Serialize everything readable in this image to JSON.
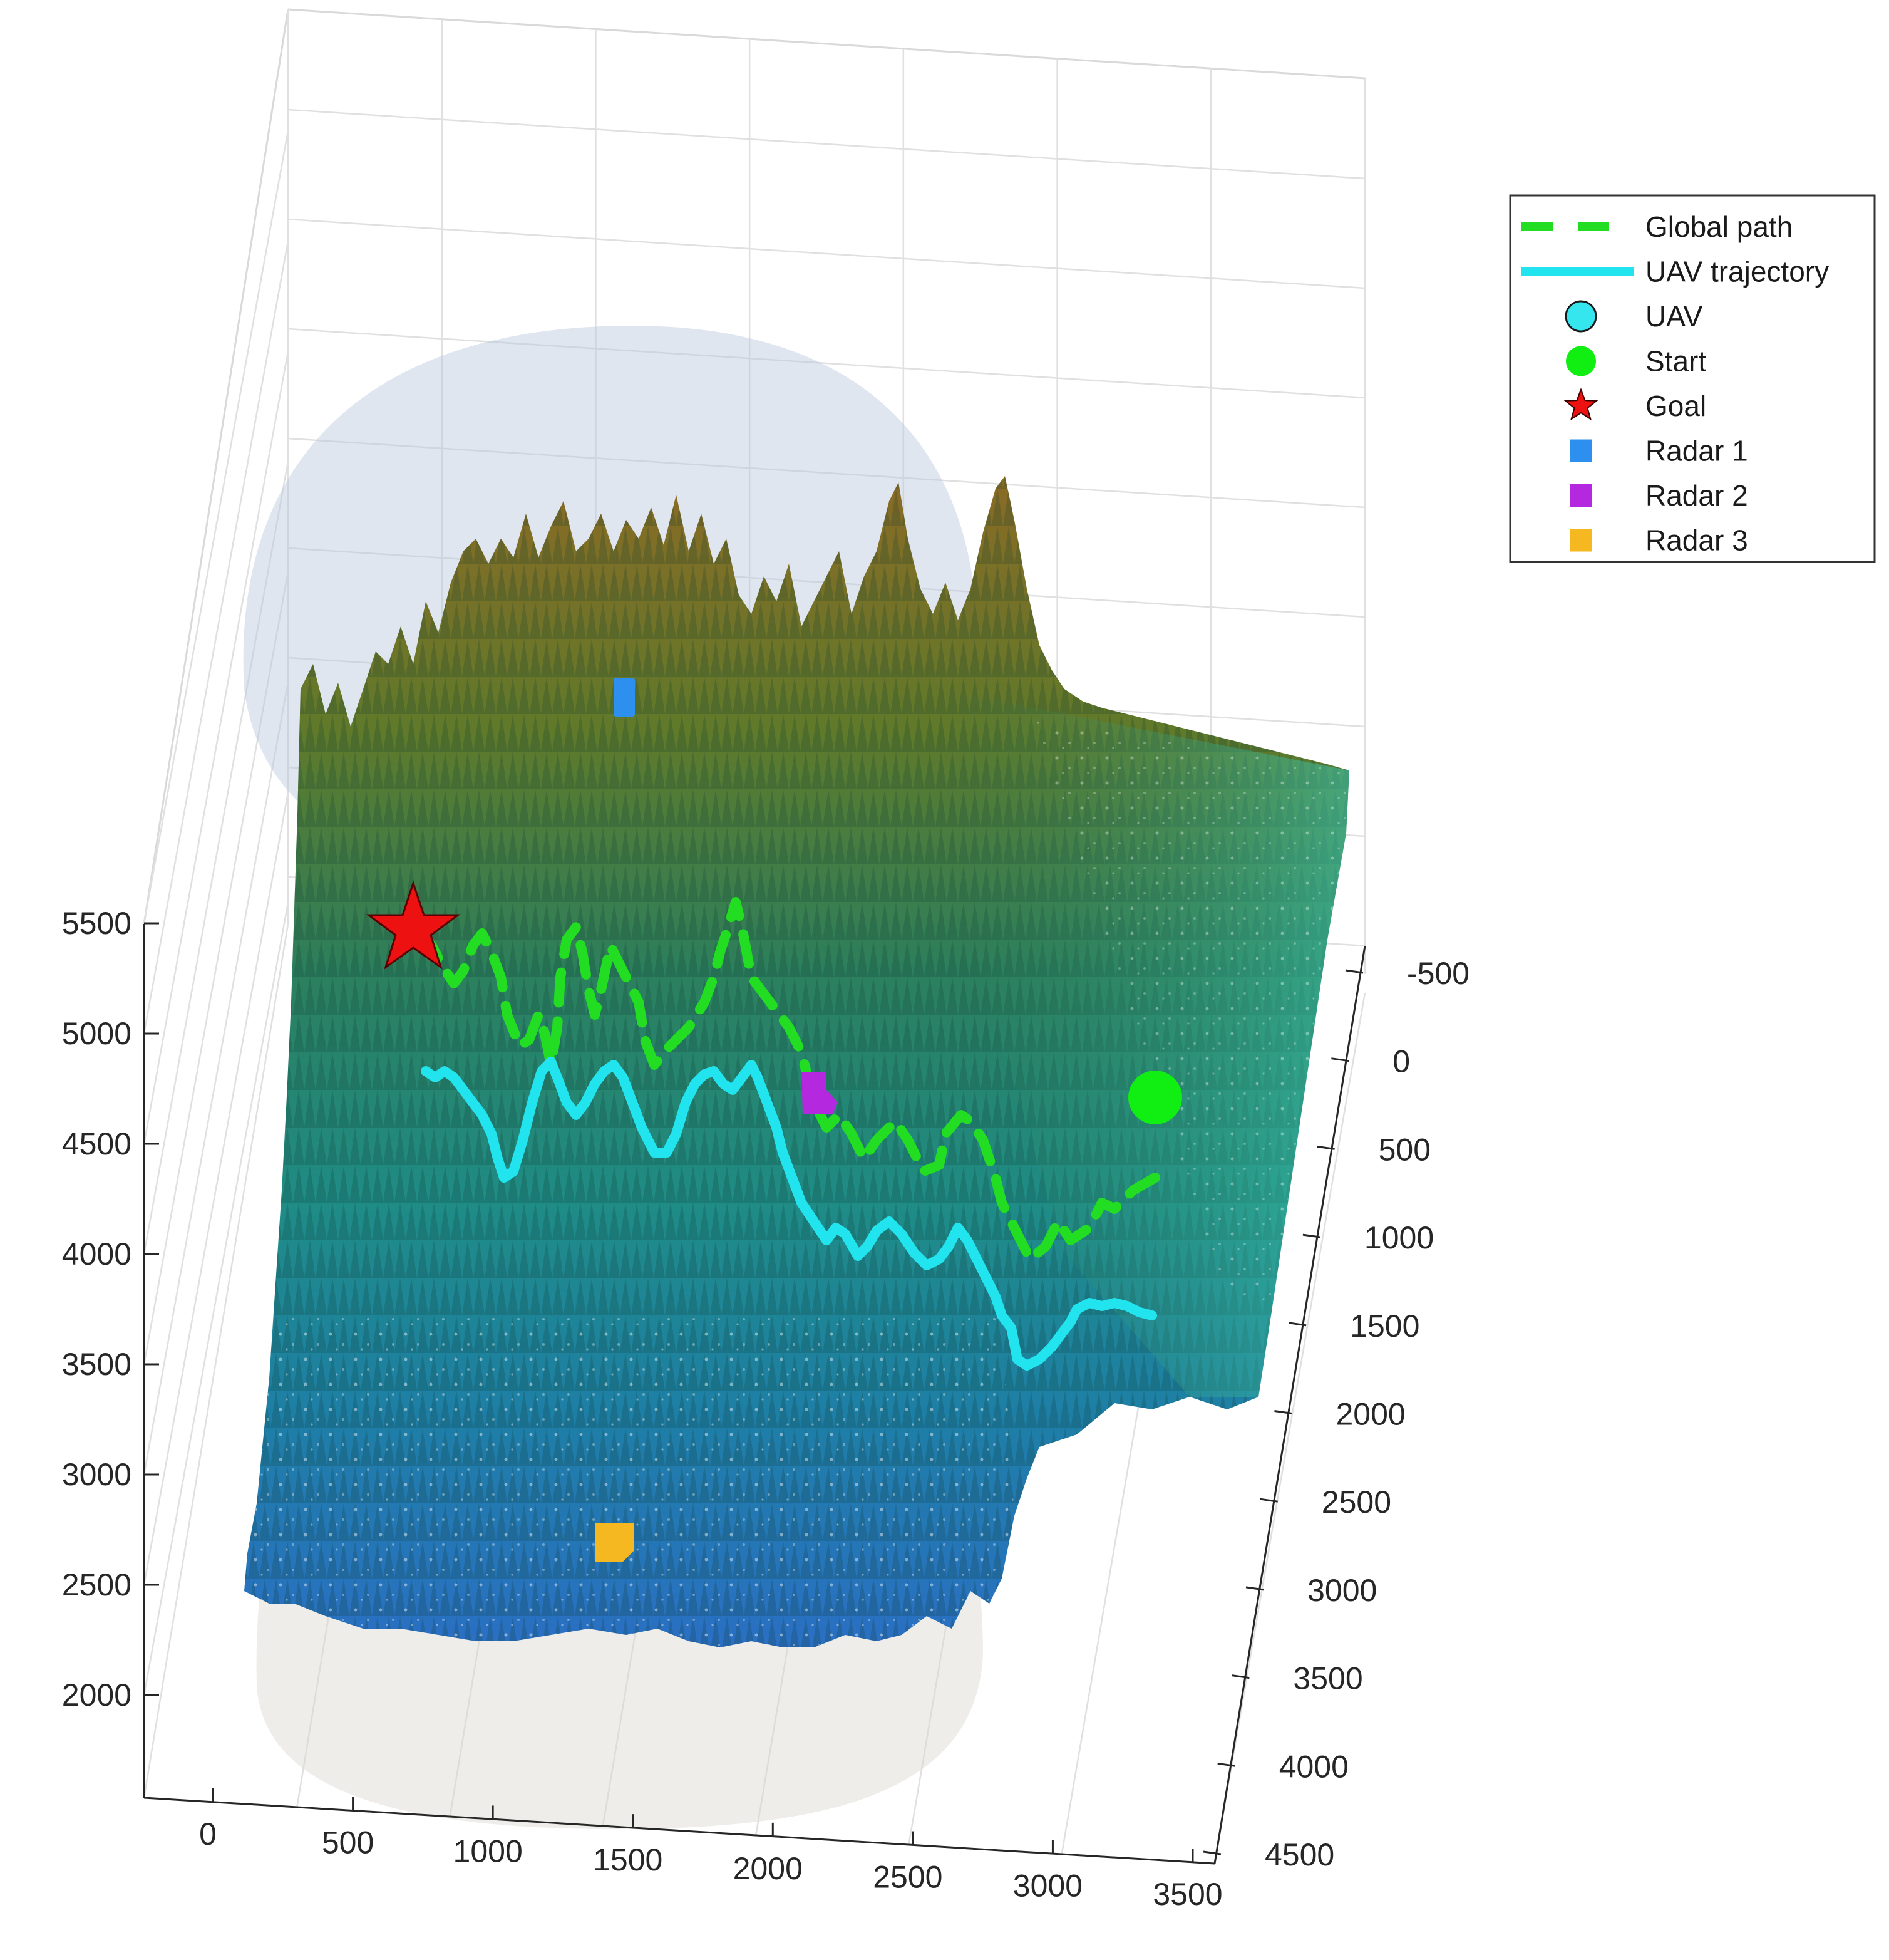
{
  "chart_data": {
    "type": "3d-surface",
    "title": "",
    "xlabel": "",
    "ylabel": "",
    "zlabel": "",
    "x_ticks": [
      0,
      500,
      1000,
      1500,
      2000,
      2500,
      3000,
      3500
    ],
    "y_ticks": [
      -500,
      0,
      500,
      1000,
      1500,
      2000,
      2500,
      3000,
      3500,
      4000,
      4500
    ],
    "z_ticks": [
      2000,
      2500,
      3000,
      3500,
      4000,
      4500,
      5000,
      5500
    ],
    "grid": true,
    "legend_position": "top-right",
    "colormap": [
      "#2a6fc4",
      "#1e8fa0",
      "#24958a",
      "#2c7f5c",
      "#4a7a2c",
      "#8a6a25"
    ],
    "legend": [
      {
        "label": "Global path",
        "kind": "dashed-line",
        "color": "#22dd22"
      },
      {
        "label": "UAV trajectory",
        "kind": "solid-line",
        "color": "#22e4ee"
      },
      {
        "label": "UAV",
        "kind": "circle",
        "color": "#36e6ee"
      },
      {
        "label": "Start",
        "kind": "circle",
        "color": "#11ee11"
      },
      {
        "label": "Goal",
        "kind": "star",
        "color": "#ee1111"
      },
      {
        "label": "Radar 1",
        "kind": "square",
        "color": "#2e90ee"
      },
      {
        "label": "Radar 2",
        "kind": "square",
        "color": "#b428e0"
      },
      {
        "label": "Radar 3",
        "kind": "square",
        "color": "#f6b820"
      }
    ]
  }
}
